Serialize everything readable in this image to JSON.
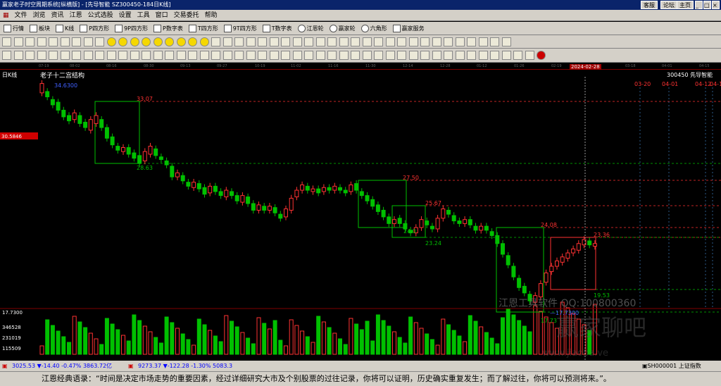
{
  "window": {
    "title": "赢家老子时空周期系统[纵横版] - [先导智能  SZ300450-184日K线]",
    "controls": [
      "客服",
      "论坛",
      "主页"
    ]
  },
  "menu": [
    "文件",
    "浏览",
    "资讯",
    "江恩",
    "公式选股",
    "设置",
    "工具",
    "窗口",
    "交易委托",
    "帮助"
  ],
  "toolbar1": [
    "行情",
    "板块",
    "K线",
    "P四方形",
    "9P四方形",
    "P数字表",
    "T四方形",
    "9T四方形",
    "T数字表",
    "江恩轮",
    "赢家轮",
    "六角形",
    "赢家服务"
  ],
  "timeaxis": {
    "dates": [
      "07-19",
      "08-02",
      "08-16",
      "08-30",
      "09-13",
      "09-27",
      "10-19",
      "11-02",
      "11-16",
      "11-30",
      "12-14",
      "12-28",
      "01-12",
      "01-26",
      "02-19",
      "2024-02-28",
      "03-18",
      "04-01",
      "04-15"
    ]
  },
  "chart": {
    "period_label": "日K线",
    "structure_title": "老子十二宫结构",
    "code_label": "300450  先导智能",
    "cursor_price": "30.5846",
    "high_label": "34.6300",
    "low_label": "—17.7300",
    "vol_top": "17.7300",
    "vol_ticks": [
      "346528",
      "231019",
      "115509"
    ],
    "future_dates": [
      "03-20",
      "04-01",
      "04-12",
      "04-1"
    ],
    "box_labels": [
      "33.07",
      "28.63",
      "27.50",
      "25.67",
      "24.0",
      "23.24",
      "24.08",
      "23.36",
      "19.53",
      "17.73"
    ],
    "watermark": "江恩工具软件  QQ:100800360",
    "watermark2": "赢家聊吧",
    "watermark3": "www.jiaoba.ve",
    "colors": {
      "up": "#ff3232",
      "down": "#00c000",
      "box_green": "#00c000",
      "box_red": "#ff3232"
    }
  },
  "chart_data": {
    "type": "candlestick",
    "title": "老子十二宫结构",
    "symbol": "SZ300450 先导智能",
    "ylim": [
      17.73,
      34.63
    ],
    "high": 34.63,
    "low": 17.73,
    "candles": [
      [
        33.9,
        34.6
      ],
      [
        34.0,
        33.6
      ],
      [
        33.4,
        33.0
      ],
      [
        33.2,
        32.6
      ],
      [
        32.6,
        32.1
      ],
      [
        32.2,
        31.8
      ],
      [
        31.9,
        32.4
      ],
      [
        32.2,
        31.6
      ],
      [
        31.7,
        31.3
      ],
      [
        31.1,
        31.9
      ],
      [
        31.6,
        32.2
      ],
      [
        31.9,
        31.3
      ],
      [
        31.3,
        30.5
      ],
      [
        30.6,
        30.0
      ],
      [
        29.9,
        29.6
      ],
      [
        29.5,
        29.8
      ],
      [
        29.8,
        29.3
      ],
      [
        29.4,
        29.0
      ],
      [
        29.2,
        28.6
      ],
      [
        28.8,
        29.5
      ],
      [
        29.3,
        29.9
      ],
      [
        29.7,
        29.2
      ],
      [
        29.1,
        28.9
      ],
      [
        28.8,
        28.5
      ],
      [
        28.4,
        27.6
      ],
      [
        27.6,
        27.9
      ],
      [
        27.7,
        27.3
      ],
      [
        27.2,
        26.9
      ],
      [
        26.8,
        27.2
      ],
      [
        27.1,
        26.7
      ],
      [
        26.8,
        26.3
      ],
      [
        26.4,
        26.9
      ],
      [
        26.9,
        26.5
      ],
      [
        26.5,
        26.2
      ],
      [
        26.1,
        26.6
      ],
      [
        26.5,
        26.2
      ],
      [
        26.2,
        25.8
      ],
      [
        25.7,
        26.2
      ],
      [
        26.1,
        25.6
      ],
      [
        25.6,
        25.1
      ],
      [
        25.1,
        25.5
      ],
      [
        25.4,
        25.1
      ],
      [
        25.1,
        25.4
      ],
      [
        25.3,
        24.9
      ],
      [
        24.8,
        24.5
      ],
      [
        24.6,
        25.2
      ],
      [
        25.1,
        26.0
      ],
      [
        26.1,
        26.6
      ],
      [
        26.6,
        27.0
      ],
      [
        26.9,
        26.6
      ],
      [
        26.5,
        26.7
      ],
      [
        26.7,
        26.4
      ],
      [
        26.5,
        26.8
      ],
      [
        26.8,
        26.6
      ],
      [
        26.6,
        26.9
      ],
      [
        26.8,
        26.6
      ],
      [
        26.6,
        26.4
      ],
      [
        26.5,
        27.0
      ],
      [
        27.1,
        26.6
      ],
      [
        26.5,
        26.2
      ],
      [
        26.2,
        25.8
      ],
      [
        25.9,
        25.4
      ],
      [
        25.5,
        25.0
      ],
      [
        25.1,
        24.6
      ],
      [
        24.6,
        24.1
      ],
      [
        24.1,
        24.4
      ],
      [
        24.5,
        24.1
      ],
      [
        24.1,
        23.7
      ],
      [
        23.6,
        23.4
      ],
      [
        23.4,
        23.8
      ],
      [
        23.8,
        24.4
      ],
      [
        24.3,
        24.0
      ],
      [
        23.9,
        23.7
      ],
      [
        23.7,
        24.5
      ],
      [
        24.5,
        25.2
      ],
      [
        25.1,
        24.8
      ],
      [
        24.7,
        24.3
      ],
      [
        24.3,
        24.1
      ],
      [
        24.1,
        24.4
      ],
      [
        24.4,
        24.0
      ],
      [
        23.9,
        23.6
      ],
      [
        23.6,
        23.9
      ],
      [
        23.9,
        23.6
      ],
      [
        23.5,
        23.2
      ],
      [
        23.2,
        22.6
      ],
      [
        22.6,
        21.8
      ],
      [
        21.7,
        21.0
      ],
      [
        20.9,
        20.1
      ],
      [
        20.0,
        19.3
      ],
      [
        19.4,
        18.9
      ],
      [
        18.8,
        18.3
      ],
      [
        18.2,
        18.7
      ],
      [
        18.6,
        19.6
      ],
      [
        19.7,
        20.4
      ],
      [
        20.5,
        20.9
      ],
      [
        20.9,
        21.3
      ],
      [
        21.2,
        21.6
      ],
      [
        21.5,
        21.9
      ],
      [
        21.9,
        22.2
      ],
      [
        22.1,
        22.6
      ],
      [
        22.5,
        22.9
      ],
      [
        22.8,
        22.5
      ],
      [
        22.4,
        22.6
      ]
    ],
    "volume_ticks": [
      115509,
      231019,
      346528
    ]
  }
}
